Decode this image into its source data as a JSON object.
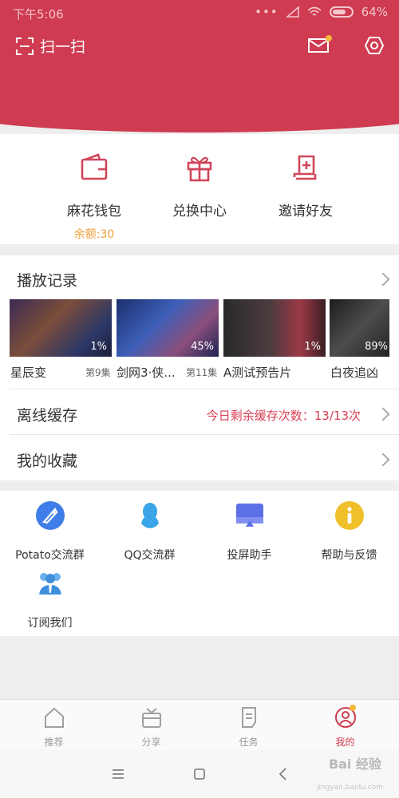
{
  "status_bar": {
    "time": "下午5:06",
    "battery": "64%"
  },
  "header": {
    "scan_label": "扫一扫"
  },
  "wallet": {
    "items": [
      {
        "label": "麻花钱包",
        "sub": "余额:30"
      },
      {
        "label": "兑换中心"
      },
      {
        "label": "邀请好友"
      }
    ]
  },
  "play_record": {
    "title": "播放记录",
    "items": [
      {
        "title": "星辰变",
        "episode": "第9集",
        "progress": "1%"
      },
      {
        "title": "剑网3·侠...",
        "episode": "第11集",
        "progress": "45%"
      },
      {
        "title": "A测试预告片",
        "episode": "",
        "progress": "1%"
      },
      {
        "title": "白夜追凶",
        "episode": "",
        "progress": "89%"
      }
    ]
  },
  "offline_cache": {
    "title": "离线缓存",
    "info": "今日剩余缓存次数：13/13次"
  },
  "favorites": {
    "title": "我的收藏"
  },
  "community": {
    "items": [
      {
        "label": "Potato交流群",
        "icon": "potato-icon"
      },
      {
        "label": "QQ交流群",
        "icon": "qq-icon"
      },
      {
        "label": "投屏助手",
        "icon": "cast-icon"
      },
      {
        "label": "帮助与反馈",
        "icon": "info-icon"
      },
      {
        "label": "订阅我们",
        "icon": "subscribe-icon"
      }
    ]
  },
  "bottom_nav": {
    "items": [
      {
        "label": "推荐",
        "icon": "home-icon"
      },
      {
        "label": "分享",
        "icon": "share-box-icon"
      },
      {
        "label": "任务",
        "icon": "task-icon"
      },
      {
        "label": "我的",
        "icon": "profile-icon",
        "active": true
      }
    ]
  },
  "watermark": {
    "text": "Bai 经验",
    "sub": "jingyan.baidu.com"
  },
  "colors": {
    "accent": "#cf3b50",
    "balance": "#f0a13a"
  }
}
